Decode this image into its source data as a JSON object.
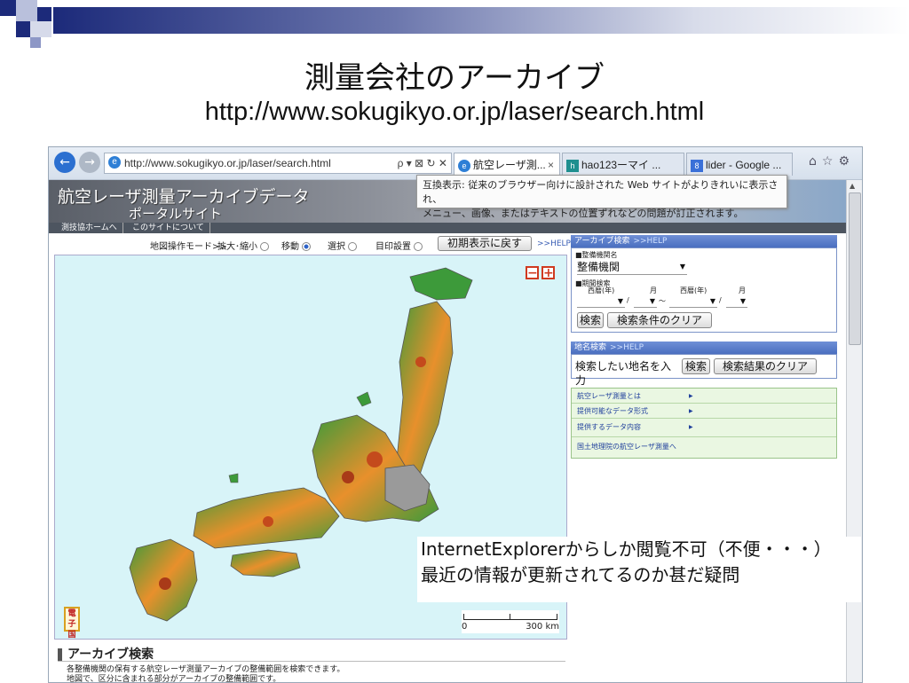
{
  "slide": {
    "title": "測量会社のアーカイブ",
    "subtitle": "http://www.sokugikyo.or.jp/laser/search.html"
  },
  "browser": {
    "address_url": "http://www.sokugikyo.or.jp/laser/search.html",
    "address_controls": "ρ ▾ ⊠ ↻ ✕",
    "tabs": [
      {
        "label": "航空レーザ測...",
        "close": "×"
      },
      {
        "label": "hao123ーマイ ...",
        "close": ""
      },
      {
        "label": "lider - Google ...",
        "close": ""
      }
    ]
  },
  "page": {
    "banner_title": "航空レーザ測量アーカイブデータ",
    "banner_subtitle": "ポータルサイト",
    "nav_links": [
      "測技協ホームへ",
      "このサイトについて"
    ],
    "compat_line1": "互換表示: 従来のブラウザー向けに設計された Web サイトがよりきれいに表示され、",
    "compat_line2": "メニュー、画像、またはテキストの位置ずれなどの問題が訂正されます。",
    "map_toolbar": {
      "mode_label": "地図操作モード>>",
      "zoom_label": "拡大･縮小",
      "move_label": "移動",
      "select_label": "選択",
      "print_label": "目印設置",
      "reset_button": "初期表示に戻す",
      "help": ">>HELP"
    },
    "map": {
      "zoom_out": "−",
      "zoom_in": "+",
      "denshi_line1": "電子",
      "denshi_line2": "国土",
      "scale_start": "0",
      "scale_end": "300 km"
    },
    "archive_heading": "アーカイブ検索",
    "archive_desc1": "各整備機関の保有する航空レーザ測量アーカイブの整備範囲を検索できます。",
    "archive_desc2": "地図で、区分に含まれる部分がアーカイブの整備範囲です。"
  },
  "right_panel": {
    "archive_search": {
      "title": "アーカイブ検索",
      "help": ">>HELP",
      "org_label": "■整備機関名",
      "org_value": "整備機関",
      "period_label": "■期間検索",
      "year_label1": "西暦(年)",
      "month_label1": "月",
      "year_label2": "西暦(年)",
      "month_label2": "月",
      "sep_slash": "/",
      "sep_tilde": "〜",
      "search_button": "検索",
      "clear_button": "検索条件のクリア"
    },
    "place_search": {
      "title": "地名検索",
      "help": ">>HELP",
      "input_placeholder": "検索したい地名を入力",
      "search_button": "検索",
      "clear_button": "検索結果のクリア"
    },
    "links": [
      "航空レーザ測量とは",
      "提供可能なデータ形式",
      "提供するデータ内容",
      "国土地理院の航空レーザ測量へ"
    ]
  },
  "callout": {
    "line1": "InternetExplorerからしか閲覧不可（不便・・・）",
    "line2": "最近の情報が更新されてるのか甚だ疑問"
  },
  "colors": {
    "accent_blue": "#1f3f9c",
    "deco_navy": "#1c2a7a",
    "map_sea": "#d8f4f8",
    "land_green": "#3d9a3a",
    "land_orange": "#e8902c"
  }
}
